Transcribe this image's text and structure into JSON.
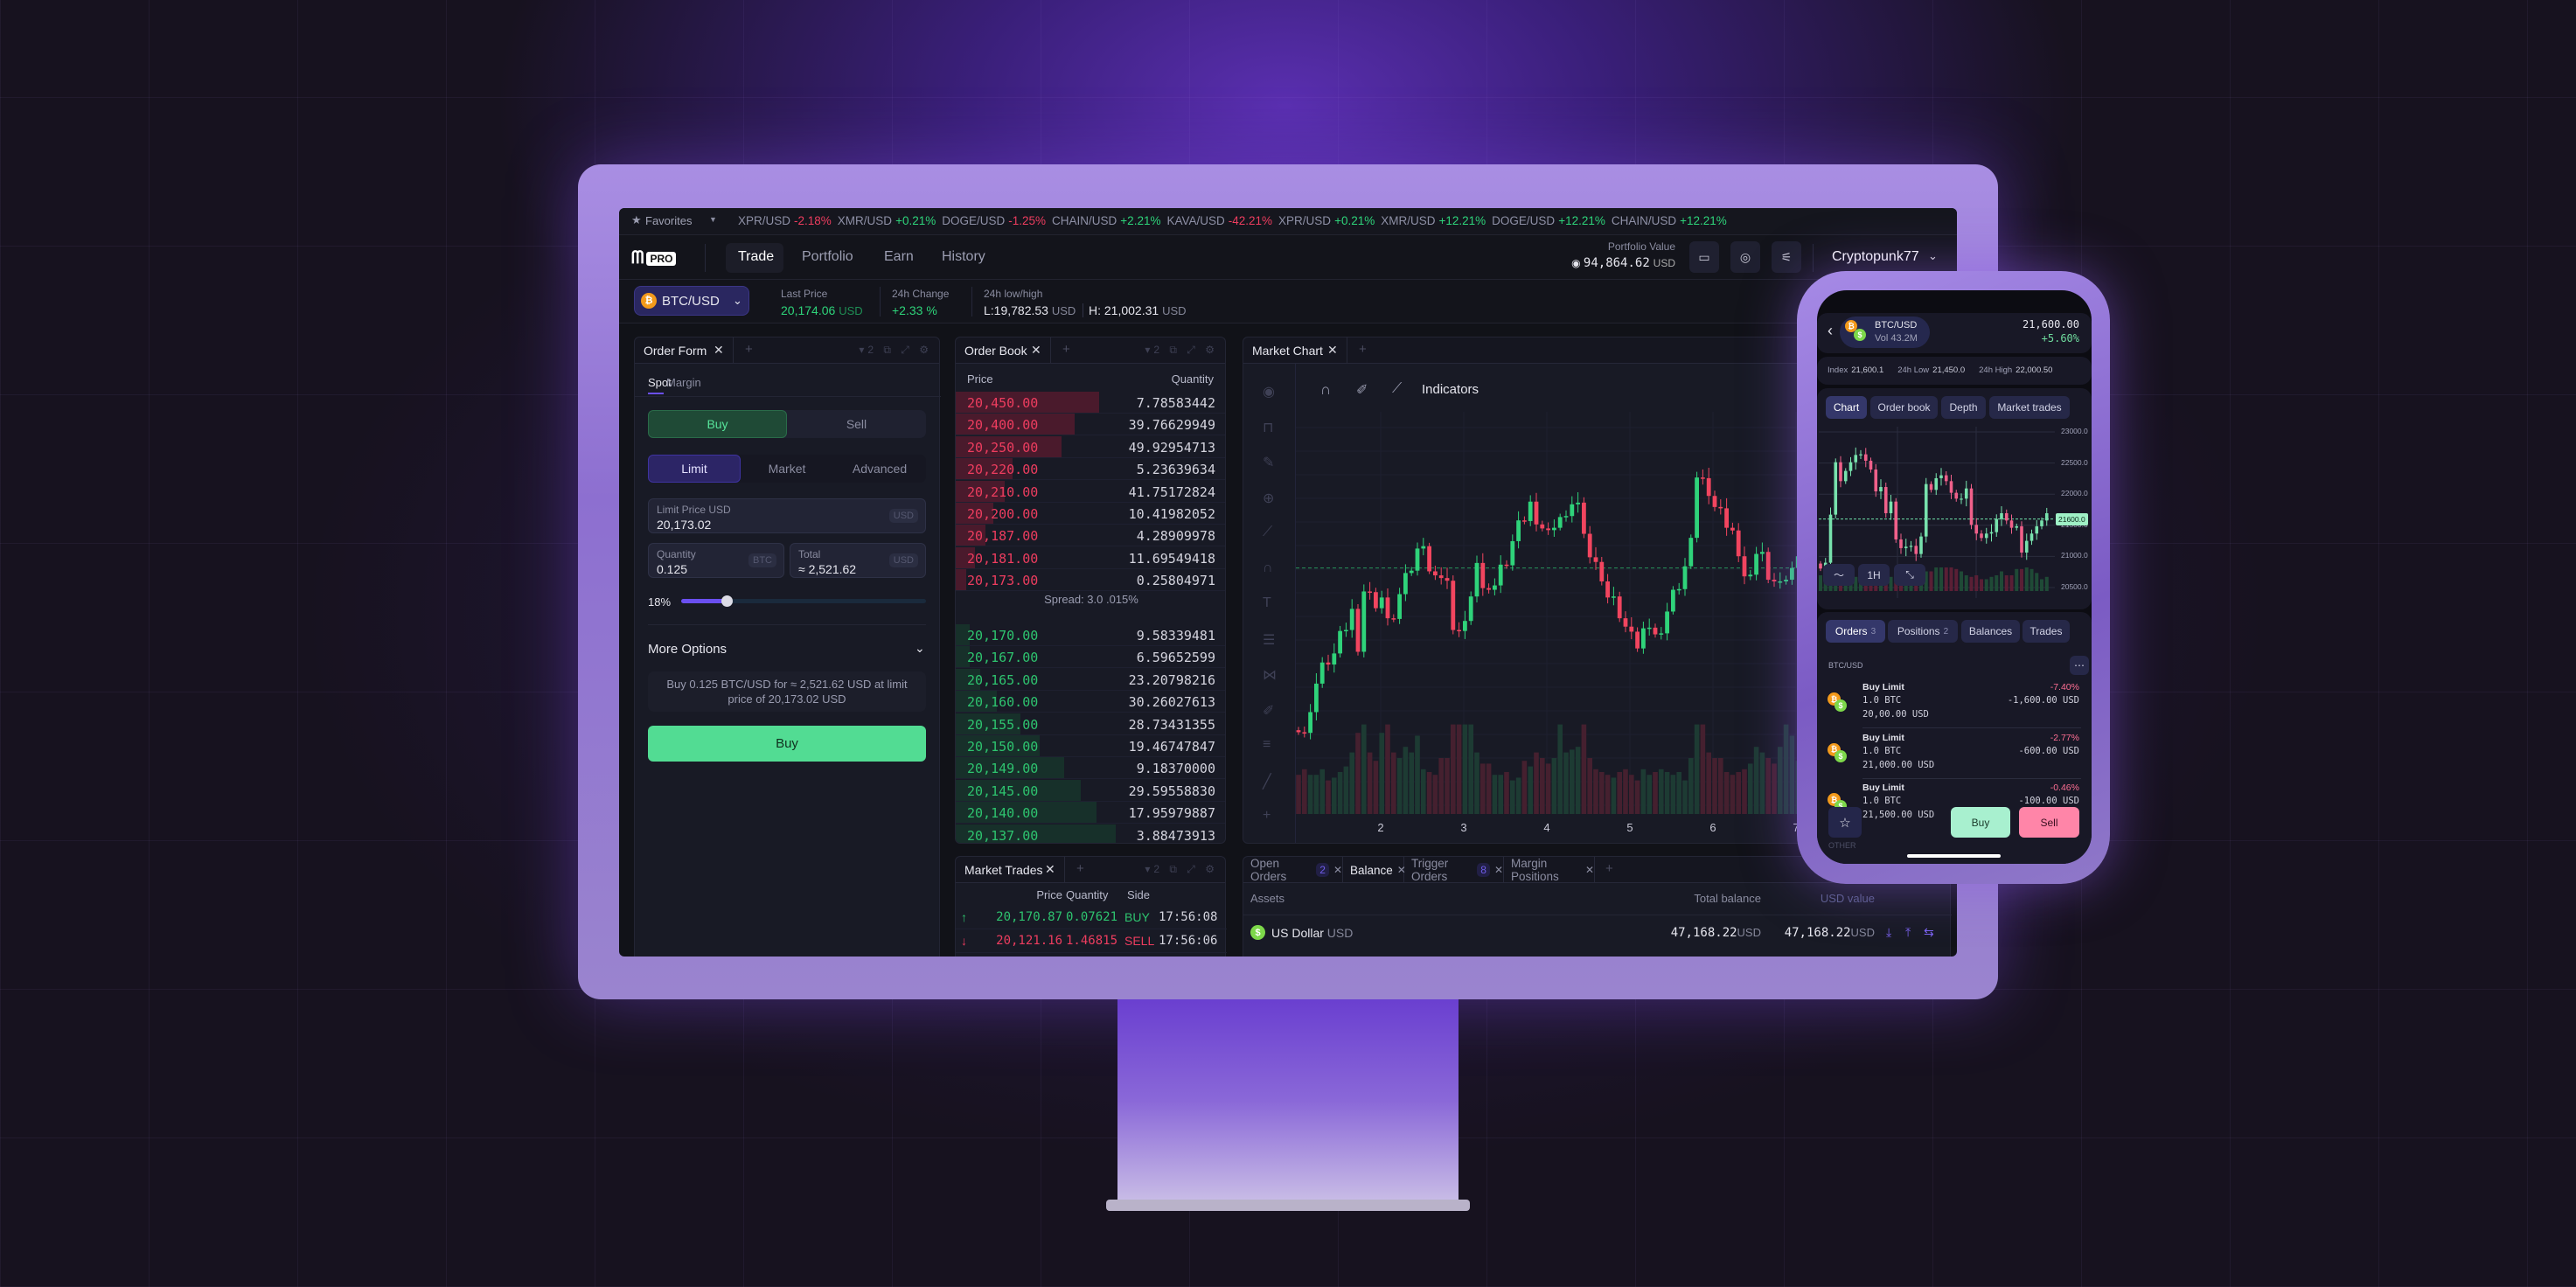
{
  "colors": {
    "accent": "#5b3fd6",
    "green": "#2ed47a",
    "red": "#ee3d5f",
    "buy_button": "#52dc93",
    "mobile_buy": "#a8f0cf",
    "mobile_sell": "#ff85a8"
  },
  "ticker": {
    "favorites": "Favorites",
    "items": [
      {
        "pair": "XPR/USD",
        "change": "-2.18%",
        "dir": "down"
      },
      {
        "pair": "XMR/USD",
        "change": "+0.21%",
        "dir": "up"
      },
      {
        "pair": "DOGE/USD",
        "change": "-1.25%",
        "dir": "down"
      },
      {
        "pair": "CHAIN/USD",
        "change": "+2.21%",
        "dir": "up"
      },
      {
        "pair": "KAVA/USD",
        "change": "-42.21%",
        "dir": "down"
      },
      {
        "pair": "XPR/USD",
        "change": "+0.21%",
        "dir": "up"
      },
      {
        "pair": "XMR/USD",
        "change": "+12.21%",
        "dir": "up"
      },
      {
        "pair": "DOGE/USD",
        "change": "+12.21%",
        "dir": "up"
      },
      {
        "pair": "CHAIN/USD",
        "change": "+12.21%",
        "dir": "up"
      }
    ]
  },
  "nav": {
    "logo": "PRO",
    "tabs": [
      "Trade",
      "Portfolio",
      "Earn",
      "History"
    ],
    "portfolio_label": "Portfolio Value",
    "portfolio_value": "94,864.62",
    "portfolio_currency": "USD",
    "username": "Cryptopunk77"
  },
  "pair": {
    "symbol": "BTC/USD",
    "last_price_label": "Last Price",
    "last_price": "20,174.06",
    "last_price_currency": "USD",
    "change_label": "24h Change",
    "change": "+2.33 %",
    "lowhigh_label": "24h low/high",
    "low": "L:19,782.53",
    "low_currency": "USD",
    "high": "H: 21,002.31",
    "high_currency": "USD"
  },
  "order_form": {
    "title": "Order Form",
    "panel_count": "2",
    "tabs": [
      "Spot",
      "Margin"
    ],
    "side": [
      "Buy",
      "Sell"
    ],
    "types": [
      "Limit",
      "Market",
      "Advanced"
    ],
    "limit_label": "Limit Price USD",
    "limit_value": "20,173.02",
    "limit_tag": "USD",
    "qty_label": "Quantity",
    "qty_value": "0.125",
    "qty_tag": "BTC",
    "total_label": "Total",
    "total_value": "≈ 2,521.62",
    "total_tag": "USD",
    "slider_label": "18%",
    "slider_percent": 18,
    "more_options": "More Options",
    "summary": "Buy 0.125 BTC/USD for ≈ 2,521.62 USD at limit price of 20,173.02 USD",
    "submit": "Buy"
  },
  "order_book": {
    "title": "Order Book",
    "panel_count": "2",
    "col_price": "Price",
    "col_qty": "Quantity",
    "spread": "Spread: 3.0 .015%",
    "asks": [
      {
        "price": "20,450.00",
        "qty": "7.78583442",
        "depth": 0.53
      },
      {
        "price": "20,400.00",
        "qty": "39.76629949",
        "depth": 0.44
      },
      {
        "price": "20,250.00",
        "qty": "49.92954713",
        "depth": 0.39
      },
      {
        "price": "20,220.00",
        "qty": "5.23639634",
        "depth": 0.21
      },
      {
        "price": "20,210.00",
        "qty": "41.75172824",
        "depth": 0.18
      },
      {
        "price": "20,200.00",
        "qty": "10.41982052",
        "depth": 0.14
      },
      {
        "price": "20,187.00",
        "qty": "4.28909978",
        "depth": 0.11
      },
      {
        "price": "20,181.00",
        "qty": "11.69549418",
        "depth": 0.07
      },
      {
        "price": "20,173.00",
        "qty": "0.25804971",
        "depth": 0.04
      }
    ],
    "bids": [
      {
        "price": "20,170.00",
        "qty": "9.58339481",
        "depth": 0.05
      },
      {
        "price": "20,167.00",
        "qty": "6.59652599",
        "depth": 0.05
      },
      {
        "price": "20,165.00",
        "qty": "23.20798216",
        "depth": 0.09
      },
      {
        "price": "20,160.00",
        "qty": "30.26027613",
        "depth": 0.15
      },
      {
        "price": "20,155.00",
        "qty": "28.73431355",
        "depth": 0.24
      },
      {
        "price": "20,150.00",
        "qty": "19.46747847",
        "depth": 0.31
      },
      {
        "price": "20,149.00",
        "qty": "9.18370000",
        "depth": 0.4
      },
      {
        "price": "20,145.00",
        "qty": "29.59558830",
        "depth": 0.46
      },
      {
        "price": "20,140.00",
        "qty": "17.95979887",
        "depth": 0.52
      },
      {
        "price": "20,137.00",
        "qty": "3.88473913",
        "depth": 0.59
      }
    ]
  },
  "market_trades": {
    "title": "Market Trades",
    "panel_count": "2",
    "cols": [
      "Price",
      "Quantity",
      "Side"
    ],
    "rows": [
      {
        "dir": "up",
        "price": "20,170.87",
        "qty": "0.07621",
        "side": "BUY",
        "time": "17:56:08"
      },
      {
        "dir": "down",
        "price": "20,121.16",
        "qty": "1.46815",
        "side": "SELL",
        "time": "17:56:06"
      }
    ]
  },
  "market_chart": {
    "title": "Market Chart",
    "indicators": "Indicators",
    "x_labels": [
      "2",
      "3",
      "4",
      "5",
      "6",
      "7"
    ],
    "last_price": 20174,
    "ylim": [
      19440,
      20640
    ],
    "open": 19690,
    "closes": [
      19684,
      19682,
      19744,
      19829,
      19892,
      19886,
      19919,
      19986,
      19989,
      20052,
      19924,
      20104,
      20102,
      20054,
      20086,
      20024,
      20022,
      20096,
      20159,
      20166,
      20232,
      20239,
      20164,
      20152,
      20144,
      20136,
      19989,
      19986,
      20016,
      20089,
      20189,
      20114,
      20109,
      20122,
      20184,
      20182,
      20254,
      20316,
      20314,
      20372,
      20304,
      20292,
      20287,
      20294,
      20326,
      20329,
      20364,
      20369,
      20276,
      20206,
      20192,
      20134,
      20086,
      20089,
      20024,
      19999,
      19984,
      19934,
      19994,
      19996,
      19976,
      19979,
      20044,
      20109,
      20111,
      20179,
      20264,
      20444,
      20442,
      20389,
      20356,
      20352,
      20294,
      20286,
      20209,
      20149,
      20154,
      20216,
      20222,
      20139,
      20134,
      20134,
      20139,
      20174,
      20209,
      20214
    ],
    "volumes": [
      28,
      32,
      28,
      28,
      32,
      24,
      26,
      30,
      34,
      44,
      58,
      64,
      44,
      38,
      58,
      64,
      44,
      40,
      48,
      44,
      56,
      32,
      30,
      28,
      40,
      40,
      64,
      64,
      64,
      64,
      44,
      36,
      36,
      28,
      28,
      30,
      24,
      26,
      38,
      34,
      44,
      40,
      36,
      40,
      64,
      44,
      46,
      48,
      64,
      40,
      32,
      30,
      28,
      26,
      30,
      32,
      28,
      24,
      32,
      28,
      30,
      32,
      30,
      28,
      30,
      24,
      40,
      64,
      64,
      44,
      40,
      40,
      30,
      28,
      30,
      32,
      36,
      48,
      44,
      40,
      36,
      48,
      64,
      56,
      38,
      26
    ],
    "toolbar_icons": [
      "eye-icon",
      "lock-icon",
      "pencil-lock-icon",
      "zoom-in-icon",
      "ruler-icon",
      "magnet-icon",
      "text-icon",
      "fib-icon",
      "pattern-icon",
      "brush-icon",
      "lines-icon",
      "trendline-icon",
      "crosshair-icon"
    ]
  },
  "balance_panel": {
    "tabs": [
      {
        "label": "Open Orders",
        "badge": "2"
      },
      {
        "label": "Balance",
        "badge": ""
      },
      {
        "label": "Trigger Orders",
        "badge": "8"
      },
      {
        "label": "Margin Positions",
        "badge": ""
      }
    ],
    "cols": [
      "Assets",
      "Total balance",
      "USD value"
    ],
    "rows": [
      {
        "name": "US Dollar",
        "code": "USD",
        "total": "47,168.22",
        "total_currency": "USD",
        "usd_value": "47,168.22",
        "usd_currency": "USD"
      }
    ]
  },
  "mobile": {
    "pair": "BTC/USD",
    "volume": "Vol 43.2M",
    "price": "21,600.00",
    "change": "+5.60%",
    "stats": [
      {
        "label": "Index",
        "value": "21,600.1"
      },
      {
        "label": "24h Low",
        "value": "21,450.0"
      },
      {
        "label": "24h High",
        "value": "22,000.50"
      }
    ],
    "chart_tabs": [
      "Chart",
      "Order book",
      "Depth",
      "Market trades"
    ],
    "y_labels": [
      "23000.0",
      "22500.0",
      "22000.0",
      "21500.0",
      "21000.0",
      "20500.0"
    ],
    "last_price_label": "21600.0",
    "last_price": 21600,
    "interval": "1H",
    "closes": [
      20805,
      20899,
      21671,
      22513,
      22209,
      22373,
      22513,
      22630,
      22640,
      22537,
      22396,
      22045,
      22115,
      21694,
      21881,
      21273,
      21133,
      21156,
      21170,
      21039,
      21320,
      22162,
      22069,
      22256,
      22303,
      22209,
      22022,
      21928,
      21928,
      22092,
      21507,
      21367,
      21296,
      21367,
      21390,
      21601,
      21694,
      21577,
      21460,
      21484,
      21062,
      21250,
      21367,
      21484,
      21577,
      21694
    ],
    "volumes": [
      40,
      30,
      30,
      40,
      30,
      30,
      30,
      36,
      36,
      30,
      30,
      36,
      30,
      40,
      36,
      36,
      30,
      30,
      30,
      36,
      40,
      50,
      50,
      60,
      60,
      60,
      60,
      56,
      50,
      40,
      36,
      40,
      30,
      30,
      36,
      40,
      50,
      40,
      40,
      56,
      56,
      60,
      56,
      46,
      30,
      36
    ],
    "list_tabs": [
      {
        "label": "Orders",
        "badge": "3"
      },
      {
        "label": "Positions",
        "badge": "2"
      },
      {
        "label": "Balances",
        "badge": ""
      },
      {
        "label": "Trades",
        "badge": ""
      }
    ],
    "section": "BTC/USD",
    "section_other": "OTHER",
    "orders": [
      {
        "type": "Buy Limit",
        "amount": "1.0 BTC",
        "price": "20,00.00 USD",
        "change": "-7.40%",
        "pnl": "-1,600.00 USD"
      },
      {
        "type": "Buy Limit",
        "amount": "1.0 BTC",
        "price": "21,000.00 USD",
        "change": "-2.77%",
        "pnl": "-600.00 USD"
      },
      {
        "type": "Buy Limit",
        "amount": "1.0 BTC",
        "price": "21,500.00 USD",
        "change": "-0.46%",
        "pnl": "-100.00 USD"
      }
    ],
    "buy": "Buy",
    "sell": "Sell"
  }
}
